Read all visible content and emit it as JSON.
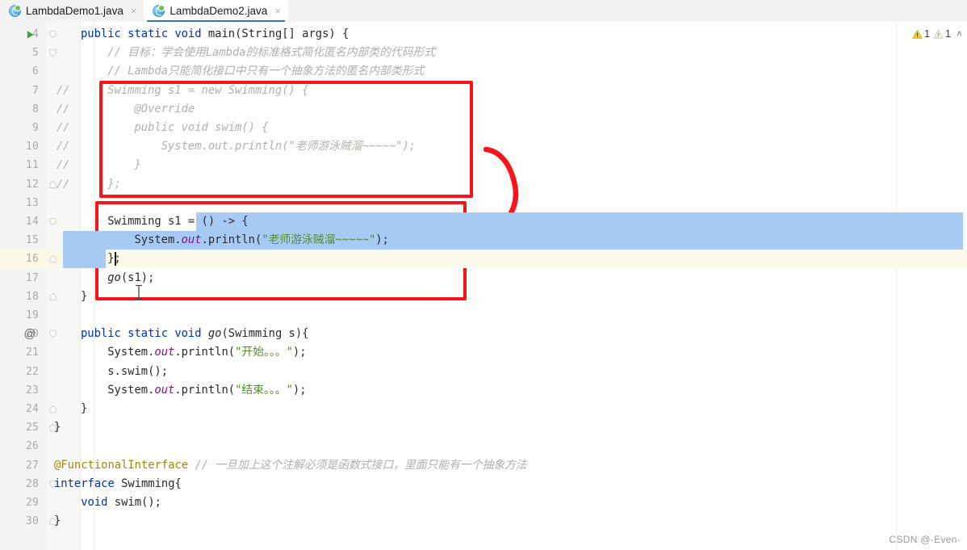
{
  "window": {
    "kind": "java-code-editor"
  },
  "tabs": [
    {
      "label": "LambdaDemo1.java",
      "icon": "java-class-icon",
      "close": "×",
      "active": false
    },
    {
      "label": "LambdaDemo2.java",
      "icon": "java-class-icon",
      "close": "×",
      "active": true
    }
  ],
  "inspections": {
    "warning_icon": "warning-triangle-icon",
    "warning_count": "1",
    "weak_warning_icon": "weak-warning-triangle-icon",
    "weak_warning_count": "1",
    "collapse": "˄"
  },
  "gutter": {
    "run_marker": "run-gutter-icon",
    "override_marker": "@"
  },
  "editor": {
    "caret_line": 16,
    "selection_lines": [
      14,
      15,
      16
    ],
    "lines": [
      {
        "n": "4",
        "marker": "run",
        "fold": "open",
        "comment": "",
        "code": "<span class=\"kw\">public</span> <span class=\"kw\">static</span> <span class=\"kw\">void</span> <span class=\"mth\">main</span>(<span class=\"cls\">String</span>[] args) {",
        "indent": 0
      },
      {
        "n": "5",
        "marker": "",
        "fold": "open",
        "comment": "",
        "code": "    <span class=\"cmt\">// <span class=\"han\">目标：学会使用</span>Lambda<span class=\"han\">的标准格式简化匿名内部类的代码形式</span></span>",
        "indent": 0
      },
      {
        "n": "6",
        "marker": "",
        "fold": "",
        "comment": "",
        "code": "    <span class=\"cmt\">// Lambda<span class=\"han\">只能简化接口中只有一个抽象方法的匿名内部类形式</span></span>",
        "indent": 0
      },
      {
        "n": "7",
        "marker": "",
        "fold": "",
        "comment": "//",
        "code": "    <span class=\"dim\">Swimming s1 = new Swimming() {</span>",
        "indent": 0
      },
      {
        "n": "8",
        "marker": "",
        "fold": "",
        "comment": "//",
        "code": "        <span class=\"dim\">@Override</span>",
        "indent": 0
      },
      {
        "n": "9",
        "marker": "",
        "fold": "",
        "comment": "//",
        "code": "        <span class=\"dim\">public void swim() {</span>",
        "indent": 0
      },
      {
        "n": "10",
        "marker": "",
        "fold": "",
        "comment": "//",
        "code": "            <span class=\"dim\">System.out.println(\"<span class=\"han\">老师游泳贼溜</span>~~~~~\");</span>",
        "indent": 0
      },
      {
        "n": "11",
        "marker": "",
        "fold": "",
        "comment": "//",
        "code": "        <span class=\"dim\">}</span>",
        "indent": 0
      },
      {
        "n": "12",
        "marker": "",
        "fold": "close",
        "comment": "//",
        "code": "    <span class=\"dim\">};</span>",
        "indent": 0
      },
      {
        "n": "13",
        "marker": "",
        "fold": "",
        "comment": "",
        "code": "",
        "indent": 0
      },
      {
        "n": "14",
        "marker": "",
        "fold": "open",
        "comment": "",
        "code": "    <span class=\"cls\">Swimming</span> s1 = () -&gt; {",
        "indent": 0
      },
      {
        "n": "15",
        "marker": "",
        "fold": "",
        "comment": "",
        "code": "        <span class=\"cls\">System</span>.<span class=\"fld\">out</span>.<span class=\"mth\">println</span>(<span class=\"str\">\"<span class=\"han\">老师游泳贼溜</span>~~~~~\"</span>);",
        "indent": 0
      },
      {
        "n": "16",
        "marker": "",
        "fold": "close",
        "comment": "",
        "code": "    };",
        "indent": 0
      },
      {
        "n": "17",
        "marker": "",
        "fold": "",
        "comment": "",
        "code": "    <span class=\"gcall\">go</span>(s1);",
        "indent": 0
      },
      {
        "n": "18",
        "marker": "",
        "fold": "close",
        "comment": "",
        "code": "}",
        "indent": 0
      },
      {
        "n": "19",
        "marker": "",
        "fold": "",
        "comment": "",
        "code": "",
        "indent": 0
      },
      {
        "n": "20",
        "marker": "@",
        "fold": "open",
        "comment": "",
        "code": "<span class=\"kw\">public</span> <span class=\"kw\">static</span> <span class=\"kw\">void</span> <span class=\"gcall\">go</span>(<span class=\"cls\">Swimming</span> s){",
        "indent": 0
      },
      {
        "n": "21",
        "marker": "",
        "fold": "",
        "comment": "",
        "code": "    <span class=\"cls\">System</span>.<span class=\"fld\">out</span>.<span class=\"mth\">println</span>(<span class=\"str\">\"<span class=\"han\">开始。。。</span>\"</span>);",
        "indent": 0
      },
      {
        "n": "22",
        "marker": "",
        "fold": "",
        "comment": "",
        "code": "    s.<span class=\"mth\">swim</span>();",
        "indent": 0
      },
      {
        "n": "23",
        "marker": "",
        "fold": "",
        "comment": "",
        "code": "    <span class=\"cls\">System</span>.<span class=\"fld\">out</span>.<span class=\"mth\">println</span>(<span class=\"str\">\"<span class=\"han\">结束。。。</span>\"</span>);",
        "indent": 0
      },
      {
        "n": "24",
        "marker": "",
        "fold": "close",
        "comment": "",
        "code": "}",
        "indent": 0
      },
      {
        "n": "25",
        "marker": "",
        "fold": "close",
        "comment": "",
        "code": "}",
        "indent": -1
      },
      {
        "n": "26",
        "marker": "",
        "fold": "",
        "comment": "",
        "code": "",
        "indent": 0
      },
      {
        "n": "27",
        "marker": "",
        "fold": "",
        "comment": "",
        "code": "<span class=\"anno\">@FunctionalInterface</span> <span class=\"cmt\">// <span class=\"han\">一旦加上这个注解必须是函数式接口，里面只能有一个抽象方法</span></span>",
        "indent": -1
      },
      {
        "n": "28",
        "marker": "",
        "fold": "open",
        "comment": "",
        "code": "<span class=\"kw\">interface</span> <span class=\"cls\">Swimming</span>{",
        "indent": -1
      },
      {
        "n": "29",
        "marker": "",
        "fold": "",
        "comment": "",
        "code": "    <span class=\"kw\">void</span> <span class=\"mth\">swim</span>();",
        "indent": -1
      },
      {
        "n": "30",
        "marker": "",
        "fold": "close",
        "comment": "",
        "code": "}",
        "indent": -1
      }
    ]
  },
  "annotations": {
    "box_anonymous_class": {
      "label": "red-box-anonymous-inner-class"
    },
    "box_lambda": {
      "label": "red-box-lambda-expression"
    },
    "arrow": {
      "label": "red-curved-arrow-down-left"
    },
    "color": "#f5151b"
  },
  "watermark": {
    "text": "CSDN @-Even-"
  },
  "colors": {
    "selection": "#a7caf5",
    "current_line": "#fcfaeb",
    "keyword": "#0033b3",
    "string": "#548c2f",
    "field": "#871094",
    "annotation": "#9e880d",
    "comment": "#b0b0ac",
    "tab_underline": "#3573c4"
  }
}
